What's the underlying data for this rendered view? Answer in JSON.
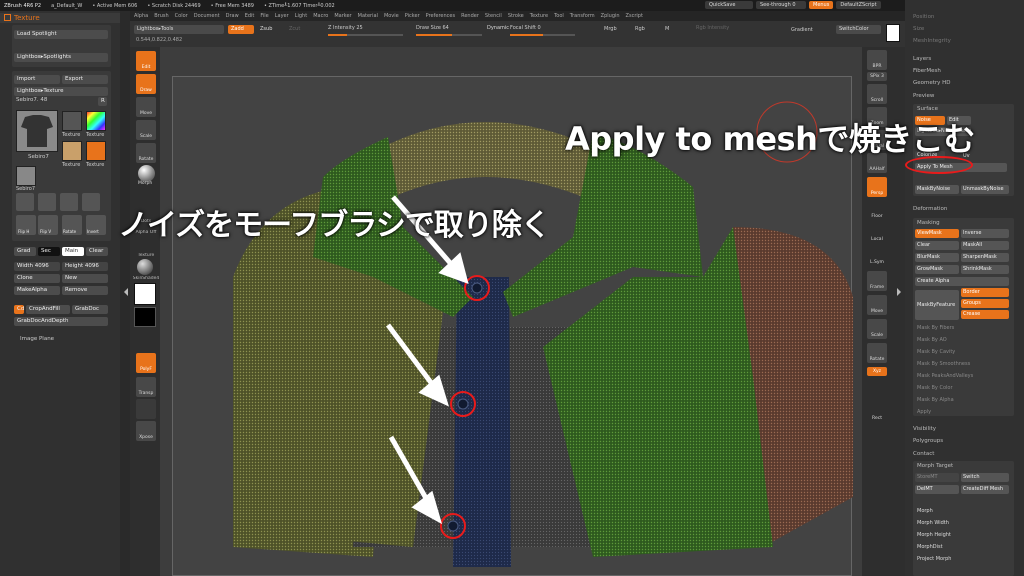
{
  "sysbar": {
    "items": [
      "ZBrush 4R6 P2",
      "a_Default_W",
      "• Active Mem 606",
      "• Scratch Disk 24469",
      "• Free Mem 3489",
      "• ZTime┸1.607 Timer┸0.002"
    ],
    "quicksave": "QuickSave",
    "seethrough": "See-through 0",
    "menus": "Menus",
    "script": "DefaultZScript"
  },
  "menubar": [
    "Alpha",
    "Brush",
    "Color",
    "Document",
    "Draw",
    "Edit",
    "File",
    "Layer",
    "Light",
    "Macro",
    "Marker",
    "Material",
    "Movie",
    "Picker",
    "Preferences",
    "Render",
    "Stencil",
    "Stroke",
    "Texture",
    "Tool",
    "Transform",
    "Zplugin",
    "Zscript"
  ],
  "toptools": {
    "lightbox_tools": "Lightbox▸Tools",
    "zadd": "Zadd",
    "zsub": "Zsub",
    "zcut": "Zcut",
    "coords": "0.544,0.822,0.482",
    "z_intensity": "Z Intensity 25",
    "draw_size": "Draw Size 64",
    "dynamic": "Dynamic",
    "focal_shift": "Focal Shift 0",
    "mrgb": "Mrgb",
    "rgb": "Rgb",
    "m": "M",
    "rgb_intensity": "Rgb Intensity",
    "gradient": "Gradient",
    "switchcolor": "SwitchColor",
    "zadd_pos": 0.25,
    "draw_pos": 0.55,
    "focal_pos": 0.5
  },
  "leftpanel": {
    "title": "Texture",
    "load_spotlight": "Load Spotlight",
    "lightbox_spotlights": "Lightbox▸Spotlights",
    "import": "Import",
    "export": "Export",
    "lightbox_texture": "Lightbox▸Texture",
    "current_texture": "Sebiro7. 48",
    "r": "R",
    "thumb_labels": [
      "Sebiro7",
      "Texture",
      "Texture",
      "Sebiro7"
    ],
    "tool_labels": [
      "Flip H",
      "Flip V",
      "Rotate",
      "Invert"
    ],
    "grad": "Grad",
    "sec": "Sec",
    "main": "Main",
    "clear": "Clear",
    "width": "Width 4096",
    "height": "Height 4096",
    "clone": "Clone",
    "new": "New",
    "makealpha": "MakeAlpha",
    "remove": "Remove",
    "cd": "Cd",
    "cropandfill": "CropAndFill",
    "grabdoc": "GrabDoc",
    "grabdocanddepth": "GrabDocAndDepth",
    "image_plane": "Image Plane"
  },
  "leftshelf": {
    "edit": "Edit",
    "draw": "Draw",
    "move": "Move",
    "scale": "Scale",
    "rotate": "Rotate",
    "morph": "Morph",
    "dots": "Dots",
    "alpha_off": "Alpha Off",
    "texture": "Texture",
    "material": "SkinShade4",
    "persp": "Persp",
    "floor": "Floor",
    "local": "Local",
    "xyz": "Xyz",
    "ghost": "Ghost",
    "spix": "SPix 3",
    "scroll": "Scroll",
    "zoom": "Zoom",
    "actual": "Actual",
    "aahalf": "AAHalf",
    "frame": "Frame",
    "lsym": "L.Sym",
    "polyf": "PolyF",
    "transp": "Transp",
    "solo": "Solo",
    "xpose": "Xpose",
    "bpr": "BPR",
    "rect": "Rect",
    "viewsize": "Viewsize"
  },
  "rightpanel": {
    "position": "Position",
    "size": "Size",
    "meshintegrity": "MeshIntegrity",
    "layers": "Layers",
    "fibermesh": "FiberMesh",
    "geometry_hd": "Geometry HD",
    "preview": "Preview",
    "surface": "Surface",
    "noise": "Noise",
    "edit": "Edit",
    "lightbox_noise": "Lightbox▸Noise Maker",
    "colorize": "Colorize",
    "uv": "Uv",
    "apply_to_mesh": "Apply To Mesh",
    "mask_by_noise": "MaskByNoise",
    "unmask_by_noise": "UnmaskByNoise",
    "deformation": "Deformation",
    "masking": "Masking",
    "viewmask": "ViewMask",
    "inverse": "Inverse",
    "clear": "Clear",
    "maskall": "MaskAll",
    "blurmask": "BlurMask",
    "sharpenmask": "SharpenMask",
    "growmask": "GrowMask",
    "shrinkmask": "ShrinkMask",
    "create_alpha": "Create Alpha",
    "border": "Border",
    "maskbyfeature": "MaskByFeature",
    "groups": "Groups",
    "crease": "Crease",
    "mask_items": [
      "Mask By Fibers",
      "Mask By AO",
      "Mask By Cavity",
      "Mask By Smoothness",
      "Mask PeaksAndValleys",
      "Mask By Color",
      "Mask By Alpha",
      "Apply"
    ],
    "visibility": "Visibility",
    "polygroups": "Polygroups",
    "contact": "Contact",
    "morph_target": "Morph Target",
    "storemt": "StoreMT",
    "switch": "Switch",
    "delmt": "DelMT",
    "creatediffmesh": "CreateDiff Mesh",
    "morph_sliders": [
      "Morph",
      "Morph Width",
      "Morph Height",
      "MorphDist"
    ],
    "project_morph": "Project Morph"
  },
  "annotations": {
    "apply": "Apply to meshで焼きこむ",
    "noise": "ノイズをモーフブラシで取り除く"
  }
}
